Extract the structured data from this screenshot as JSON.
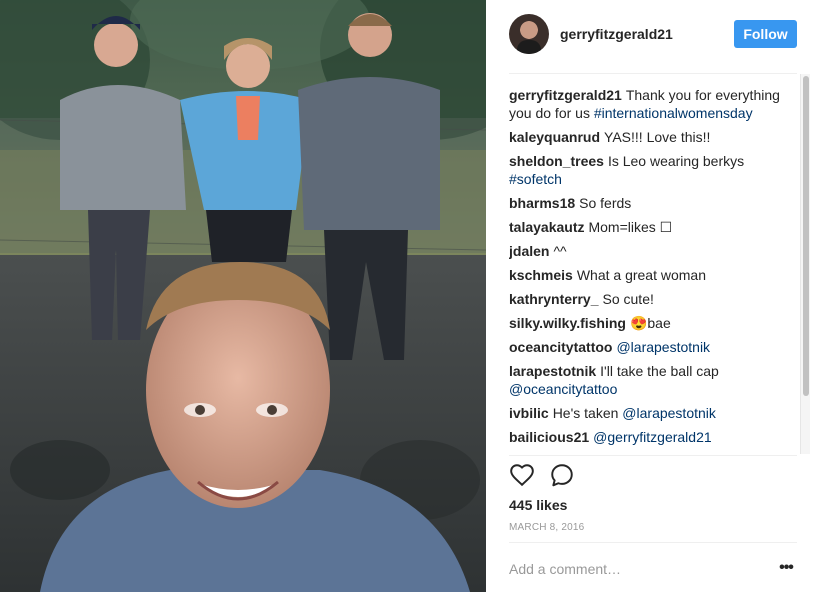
{
  "post": {
    "username": "gerryfitzgerald21",
    "follow_label": "Follow",
    "likes": "445 likes",
    "date": "MARCH 8, 2016",
    "comment_placeholder": "Add a comment…",
    "more_glyph": "•••"
  },
  "comments": [
    {
      "user": "gerryfitzgerald21",
      "text": "Thank you for everything you do for us",
      "link": "#internationalwomensday"
    },
    {
      "user": "kaleyquanrud",
      "text": "YAS!!! Love this!!",
      "link": ""
    },
    {
      "user": "sheldon_trees",
      "text": "Is Leo wearing berkys",
      "link": "#sofetch"
    },
    {
      "user": "bharms18",
      "text": "So ferds",
      "link": ""
    },
    {
      "user": "talayakautz",
      "text": "Mom=likes ☐",
      "link": ""
    },
    {
      "user": "jdalen",
      "text": "^^",
      "link": ""
    },
    {
      "user": "kschmeis",
      "text": "What a great woman",
      "link": ""
    },
    {
      "user": "kathrynterry_",
      "text": "So cute!",
      "link": ""
    },
    {
      "user": "silky.wilky.fishing",
      "text": "😍bae",
      "link": ""
    },
    {
      "user": "oceancitytattoo",
      "text": "",
      "link": "@larapestotnik"
    },
    {
      "user": "larapestotnik",
      "text": "I'll take the ball cap",
      "link": "@oceancitytattoo"
    },
    {
      "user": "ivbilic",
      "text": "He's taken",
      "link": "@larapestotnik"
    },
    {
      "user": "bailicious21",
      "text": "",
      "link": "@gerryfitzgerald21"
    }
  ],
  "icons": {
    "like": "heart-icon",
    "comment": "comment-bubble-icon",
    "more": "more-options-icon"
  },
  "colors": {
    "follow_button": "#3897f0",
    "link": "#003569",
    "meta_gray": "#999999"
  }
}
